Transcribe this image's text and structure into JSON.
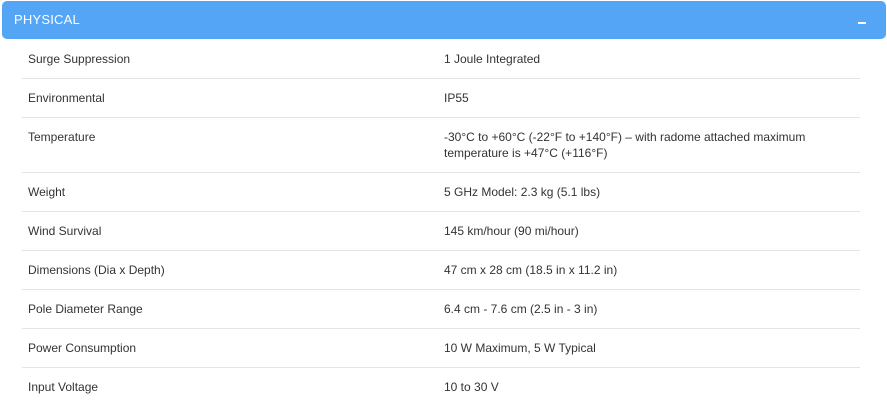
{
  "panel": {
    "title": "PHYSICAL",
    "collapse_icon": "minus-icon",
    "header_color": "#54a5f5"
  },
  "specs": [
    {
      "label": "Surge Suppression",
      "value": "1 Joule Integrated"
    },
    {
      "label": "Environmental",
      "value": "IP55"
    },
    {
      "label": "Temperature",
      "value": "-30°C to +60°C (-22°F to +140°F) – with radome attached maximum temperature is +47°C (+116°F)"
    },
    {
      "label": "Weight",
      "value": "5 GHz Model: 2.3 kg (5.1 lbs)"
    },
    {
      "label": "Wind Survival",
      "value": "145 km/hour (90 mi/hour)"
    },
    {
      "label": "Dimensions (Dia x Depth)",
      "value": "47 cm x 28 cm (18.5 in x 11.2 in)"
    },
    {
      "label": "Pole Diameter Range",
      "value": "6.4 cm - 7.6 cm (2.5 in - 3 in)"
    },
    {
      "label": "Power Consumption",
      "value": "10 W Maximum, 5 W Typical"
    },
    {
      "label": "Input Voltage",
      "value": "10 to 30 V"
    }
  ]
}
